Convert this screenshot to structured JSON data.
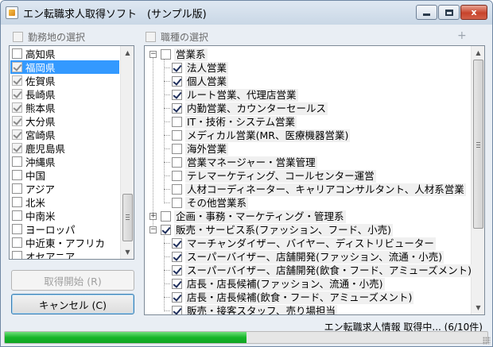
{
  "window": {
    "title": "エン転職求人取得ソフト　(サンプル版)",
    "close_glyph": "x"
  },
  "left_panel": {
    "header_label": "勤務地の選択",
    "items": [
      {
        "label": "高知県",
        "checked": false,
        "selected": false
      },
      {
        "label": "福岡県",
        "checked": true,
        "selected": true
      },
      {
        "label": "佐賀県",
        "checked": true,
        "selected": false
      },
      {
        "label": "長崎県",
        "checked": true,
        "selected": false
      },
      {
        "label": "熊本県",
        "checked": true,
        "selected": false
      },
      {
        "label": "大分県",
        "checked": true,
        "selected": false
      },
      {
        "label": "宮崎県",
        "checked": true,
        "selected": false
      },
      {
        "label": "鹿児島県",
        "checked": true,
        "selected": false
      },
      {
        "label": "沖縄県",
        "checked": false,
        "selected": false
      },
      {
        "label": "中国",
        "checked": false,
        "selected": false
      },
      {
        "label": "アジア",
        "checked": false,
        "selected": false
      },
      {
        "label": "北米",
        "checked": false,
        "selected": false
      },
      {
        "label": "中南米",
        "checked": false,
        "selected": false
      },
      {
        "label": "ヨーロッパ",
        "checked": false,
        "selected": false
      },
      {
        "label": "中近東・アフリカ",
        "checked": false,
        "selected": false
      },
      {
        "label": "オセアニア",
        "checked": false,
        "selected": false
      }
    ]
  },
  "right_panel": {
    "header_label": "職種の選択",
    "plus_minus": "+ −",
    "tree": [
      {
        "label": "営業系",
        "level": 0,
        "checked": false,
        "expander": "−"
      },
      {
        "label": "法人営業",
        "level": 1,
        "checked": true
      },
      {
        "label": "個人営業",
        "level": 1,
        "checked": true
      },
      {
        "label": "ルート営業、代理店営業",
        "level": 1,
        "checked": true
      },
      {
        "label": "内勤営業、カウンターセールス",
        "level": 1,
        "checked": true
      },
      {
        "label": "IT・技術・システム営業",
        "level": 1,
        "checked": false
      },
      {
        "label": "メディカル営業(MR、医療機器営業)",
        "level": 1,
        "checked": false
      },
      {
        "label": "海外営業",
        "level": 1,
        "checked": false
      },
      {
        "label": "営業マネージャー・営業管理",
        "level": 1,
        "checked": false
      },
      {
        "label": "テレマーケティング、コールセンター運営",
        "level": 1,
        "checked": false
      },
      {
        "label": "人材コーディネーター、キャリアコンサルタント、人材系営業",
        "level": 1,
        "checked": false
      },
      {
        "label": "その他営業系",
        "level": 1,
        "checked": false
      },
      {
        "label": "企画・事務・マーケティング・管理系",
        "level": 0,
        "checked": false,
        "expander": "+"
      },
      {
        "label": "販売・サービス系(ファッション、フード、小売)",
        "level": 0,
        "checked": true,
        "expander": "−"
      },
      {
        "label": "マーチャンダイザー、バイヤー、ディストリビューター",
        "level": 1,
        "checked": true
      },
      {
        "label": "スーパーバイザー、店舗開発(ファッション、流通・小売)",
        "level": 1,
        "checked": true
      },
      {
        "label": "スーパーバイザー、店舗開発(飲食・フード、アミューズメント)",
        "level": 1,
        "checked": true
      },
      {
        "label": "店長・店長候補(ファッション、流通・小売)",
        "level": 1,
        "checked": true
      },
      {
        "label": "店長・店長候補(飲食・フード、アミューズメント)",
        "level": 1,
        "checked": true
      },
      {
        "label": "販売・接客スタッフ、売り場担当",
        "level": 1,
        "checked": true
      }
    ]
  },
  "buttons": {
    "start_label": "取得開始 (R)",
    "cancel_label": "キャンセル (C)"
  },
  "status": {
    "text": "エン転職求人情報 取得中... (6/10件)",
    "progress_fraction": 0.5
  },
  "colors": {
    "selection": "#3399ff",
    "progress": "#16b52a",
    "close_button": "#c7432b"
  }
}
